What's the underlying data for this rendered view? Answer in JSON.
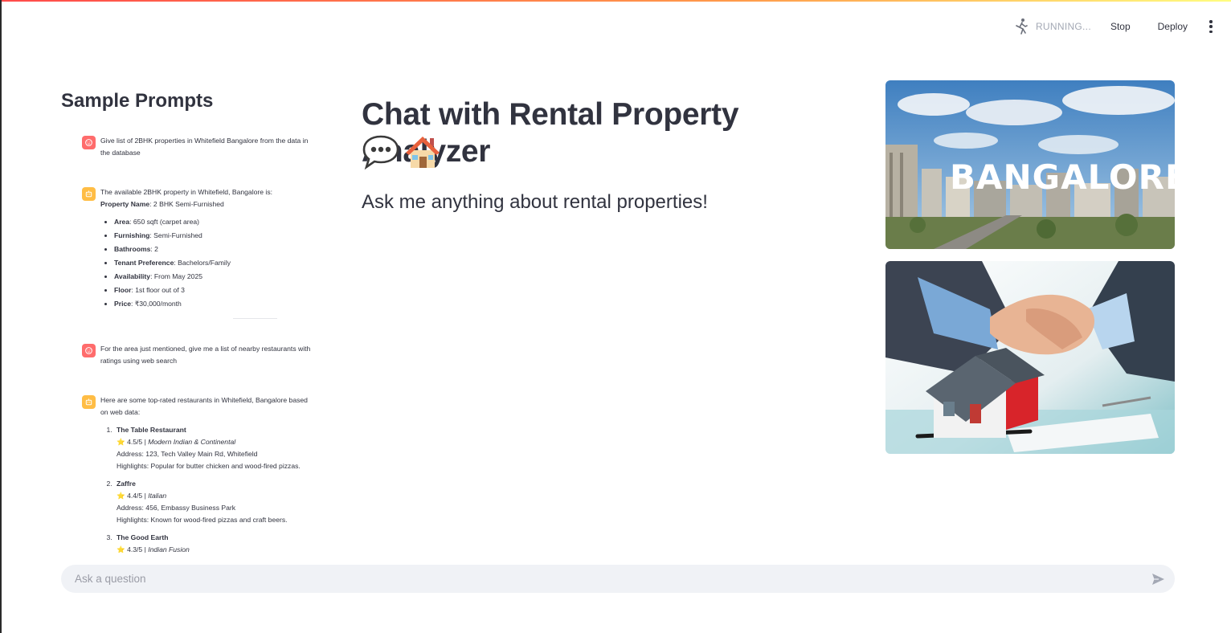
{
  "header": {
    "status": "RUNNING...",
    "stop_label": "Stop",
    "deploy_label": "Deploy"
  },
  "sidebar": {
    "title": "Sample Prompts",
    "messages": [
      {
        "role": "user",
        "text": "Give list of 2BHK properties in Whitefield Bangalore from the data in the database"
      },
      {
        "role": "assistant",
        "intro": "The available 2BHK property in Whitefield, Bangalore is:",
        "property_label": "Property Name",
        "property_value": ": 2 BHK Semi-Furnished",
        "details": [
          {
            "label": "Area",
            "value": ": 650 sqft (carpet area)"
          },
          {
            "label": "Furnishing",
            "value": ": Semi-Furnished"
          },
          {
            "label": "Bathrooms",
            "value": ": 2"
          },
          {
            "label": "Tenant Preference",
            "value": ": Bachelors/Family"
          },
          {
            "label": "Availability",
            "value": ": From May 2025"
          },
          {
            "label": "Floor",
            "value": ": 1st floor out of 3"
          },
          {
            "label": "Price",
            "value": ": ₹30,000/month"
          }
        ]
      },
      {
        "role": "user",
        "text": "For the area just mentioned, give me a list of nearby restaurants with ratings using web search"
      },
      {
        "role": "assistant",
        "intro": "Here are some top-rated restaurants in Whitefield, Bangalore based on web data:",
        "restaurants": [
          {
            "name": "The Table Restaurant",
            "star": "⭐",
            "rating": " 4.5/5 | ",
            "cuisine": "Modern Indian & Continental",
            "address": "Address: 123, Tech Valley Main Rd, Whitefield",
            "highlights": "Highlights: Popular for butter chicken and wood-fired pizzas."
          },
          {
            "name": "Zaffre",
            "star": "⭐",
            "rating": " 4.4/5 | ",
            "cuisine": "Italian",
            "address": "Address: 456, Embassy Business Park",
            "highlights": "Highlights: Known for wood-fired pizzas and craft beers."
          },
          {
            "name": "The Good Earth",
            "star": "⭐",
            "rating": " 4.3/5 | ",
            "cuisine": "Indian Fusion"
          }
        ]
      }
    ]
  },
  "main": {
    "title": "Chat with Rental Property Analyzer",
    "emojis": [
      "speech-balloon-icon",
      "house-icon"
    ],
    "subtitle": "Ask me anything about rental properties!",
    "images": [
      {
        "name": "bangalore-skyline-image",
        "caption_text": "BANGALORE"
      },
      {
        "name": "handshake-house-image"
      }
    ]
  },
  "chat_input": {
    "placeholder": "Ask a question"
  },
  "colors": {
    "user_avatar": "#ff6c6c",
    "assistant_avatar": "#ffbd45",
    "input_bg": "#f0f2f6",
    "text": "#31333f"
  }
}
